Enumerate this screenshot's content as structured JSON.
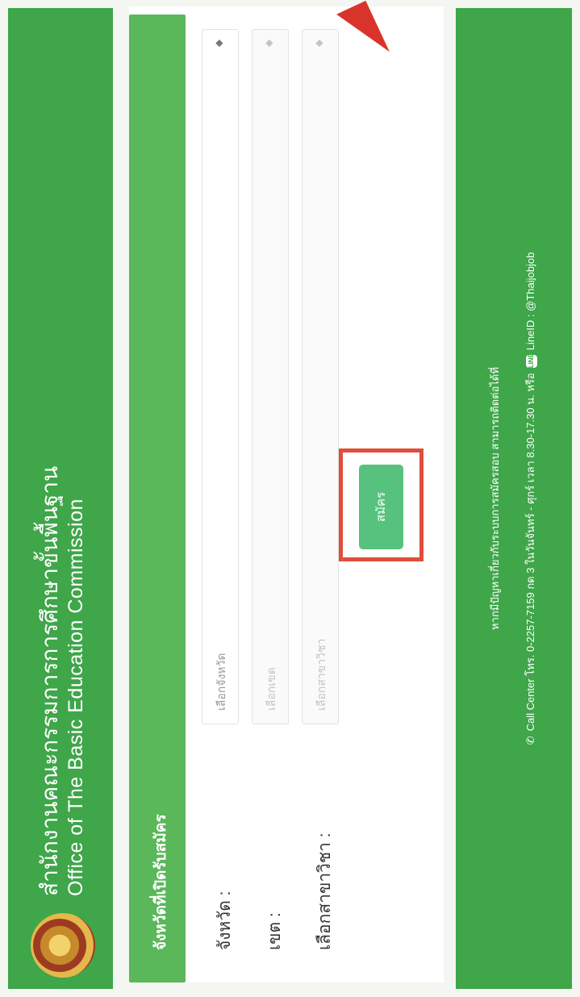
{
  "header": {
    "title_th": "สำนักงานคณะกรรมการการศึกษาขั้นพื้นฐาน",
    "title_en": "Office of The Basic Education Commission"
  },
  "panel": {
    "heading": "จังหวัดที่เปิดรับสมัคร",
    "fields": [
      {
        "label": "จังหวัด :",
        "placeholder": "เลือกจังหวัด",
        "arrow": "◆"
      },
      {
        "label": "เขต :",
        "placeholder": "เลือกเขต",
        "arrow": "◆"
      },
      {
        "label": "เลือกสาขาวิชา :",
        "placeholder": "เลือกสาขาวิชา",
        "arrow": "◆"
      }
    ],
    "apply_label": "สมัคร"
  },
  "footer": {
    "notice": "หากมีปัญหาเกี่ยวกับระบบการสมัครสอบ สามารถติดต่อได้ที่",
    "contact_prefix": "Call Center โทร. 0-2257-7159 กด 3 ในวันจันทร์ - ศุกร์ เวลา 8.30-17.30 น. หรือ",
    "line_badge": "LINE",
    "contact_suffix": "LineID : @Thaijobjob"
  },
  "colors": {
    "brand_green": "#3fa64a",
    "panel_header": "#5ab75a",
    "apply_button": "#56c27d",
    "highlight": "#e04e3c"
  }
}
